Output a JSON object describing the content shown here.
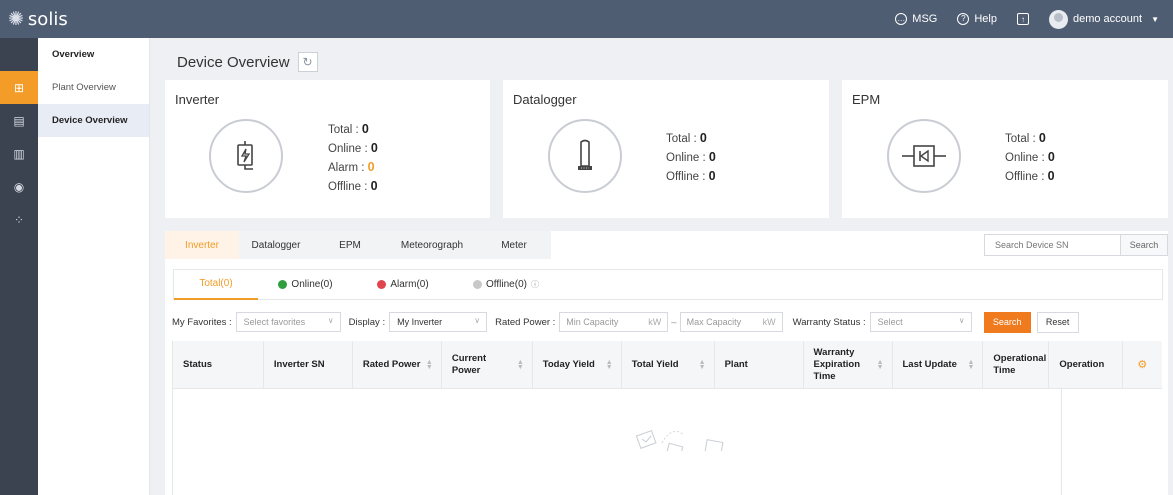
{
  "app": {
    "brand": "solis",
    "top": {
      "msg": "MSG",
      "help": "Help",
      "account": "demo account"
    }
  },
  "sidebar": {
    "items": [
      {
        "label": "Overview"
      },
      {
        "label": "Plant Overview"
      },
      {
        "label": "Device Overview"
      }
    ]
  },
  "page": {
    "title": "Device Overview"
  },
  "cards": {
    "inverter": {
      "title": "Inverter",
      "stats": [
        {
          "label": "Total",
          "value": "0"
        },
        {
          "label": "Online",
          "value": "0"
        },
        {
          "label": "Alarm",
          "value": "0"
        },
        {
          "label": "Offline",
          "value": "0"
        }
      ]
    },
    "datalogger": {
      "title": "Datalogger",
      "stats": [
        {
          "label": "Total",
          "value": "0"
        },
        {
          "label": "Online",
          "value": "0"
        },
        {
          "label": "Offline",
          "value": "0"
        }
      ]
    },
    "epm": {
      "title": "EPM",
      "stats": [
        {
          "label": "Total",
          "value": "0"
        },
        {
          "label": "Online",
          "value": "0"
        },
        {
          "label": "Offline",
          "value": "0"
        }
      ]
    }
  },
  "tabs": [
    "Inverter",
    "Datalogger",
    "EPM",
    "Meteorograph",
    "Meter"
  ],
  "search": {
    "placeholder": "Search Device SN",
    "button": "Search"
  },
  "subtabs": [
    "Total(0)",
    "Online(0)",
    "Alarm(0)",
    "Offline(0)"
  ],
  "filters": {
    "favorites_label": "My Favorites :",
    "favorites_placeholder": "Select favorites",
    "display_label": "Display :",
    "display_value": "My Inverter",
    "rated_label": "Rated Power :",
    "min_placeholder": "Min Capacity",
    "max_placeholder": "Max Capacity",
    "unit": "kW",
    "dash": "–",
    "warranty_label": "Warranty Status :",
    "warranty_placeholder": "Select",
    "search": "Search",
    "reset": "Reset"
  },
  "table": {
    "columns": [
      "Status",
      "Inverter SN",
      "Rated Power",
      "Current Power",
      "Today Yield",
      "Total Yield",
      "Plant",
      "Warranty Expiration Time",
      "Last Update",
      "Operational Time",
      "Operation"
    ]
  },
  "colors": {
    "accent": "#f39c28",
    "online": "#2e9e3e",
    "alarm": "#e0454e",
    "offline": "#c8c8c8"
  },
  "icons": [
    "sun-logo-icon",
    "message-icon",
    "help-icon",
    "export-icon",
    "user-avatar",
    "plant-icon",
    "device-icon",
    "chart-icon",
    "eye-icon",
    "apps-icon",
    "refresh-icon",
    "inverter-icon",
    "datalogger-icon",
    "epm-icon",
    "gear-icon"
  ]
}
